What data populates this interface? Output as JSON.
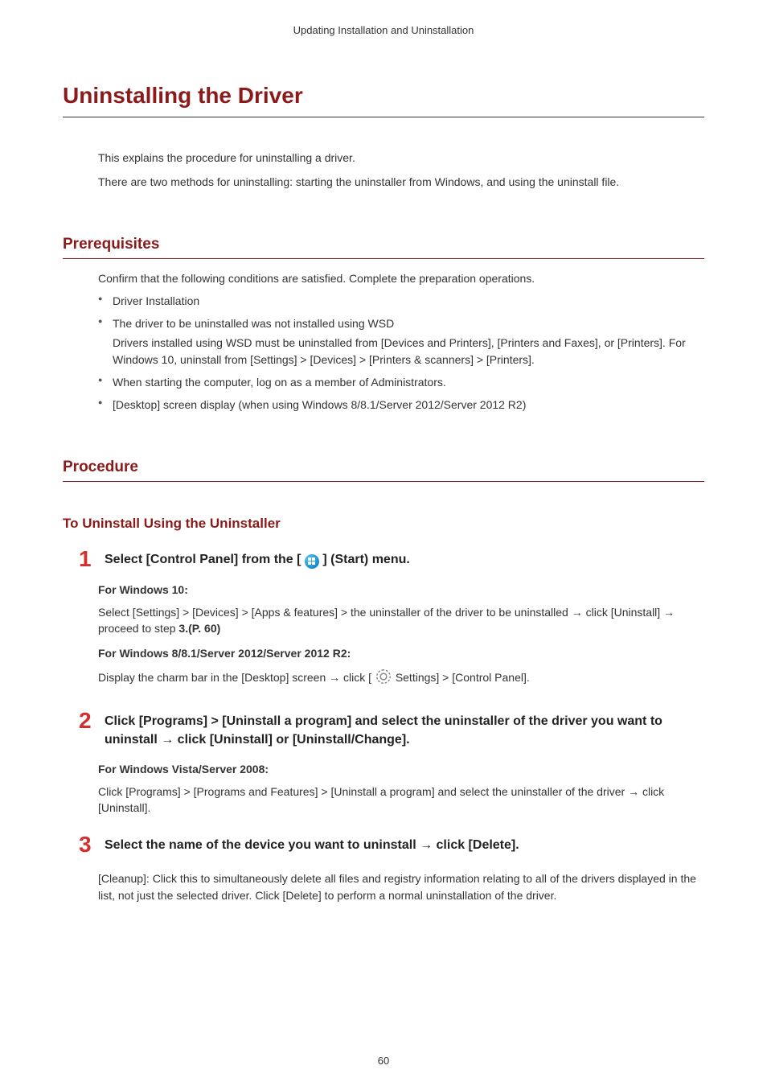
{
  "running_header": "Updating Installation and Uninstallation",
  "title": "Uninstalling the Driver",
  "intro": {
    "p1": "This explains the procedure for uninstalling a driver.",
    "p2": "There are two methods for uninstalling: starting the uninstaller from Windows, and using the uninstall file."
  },
  "prerequisites": {
    "heading": "Prerequisites",
    "lead": "Confirm that the following conditions are satisfied. Complete the preparation operations.",
    "items": [
      {
        "text": "Driver Installation"
      },
      {
        "text": "The driver to be uninstalled was not installed using WSD",
        "note": "Drivers installed using WSD must be uninstalled from [Devices and Printers], [Printers and Faxes], or [Printers]. For Windows 10, uninstall from [Settings] > [Devices] > [Printers & scanners] > [Printers]."
      },
      {
        "text": "When starting the computer, log on as a member of Administrators."
      },
      {
        "text": "[Desktop] screen display (when using Windows 8/8.1/Server 2012/Server 2012 R2)"
      }
    ]
  },
  "procedure": {
    "heading": "Procedure",
    "sub_heading": "To Uninstall Using the Uninstaller",
    "steps": [
      {
        "number": "1",
        "title_before": "Select [Control Panel] from the [",
        "title_after": "] (Start) menu.",
        "body": {
          "win10_head": "For Windows 10:",
          "win10_text_a": "Select [Settings] > [Devices] > [Apps & features] > the uninstaller of the driver to be uninstalled → click [Uninstall] → proceed to step ",
          "win10_ref": "3.(P. 60)",
          "win8_head": "For Windows 8/8.1/Server 2012/Server 2012 R2:",
          "win8_text_a": "Display the charm bar in the [Desktop] screen → click [",
          "win8_text_b": " Settings] > [Control Panel]."
        }
      },
      {
        "number": "2",
        "title": "Click [Programs] > [Uninstall a program] and select the uninstaller of the driver you want to uninstall → click [Uninstall] or [Uninstall/Change].",
        "body": {
          "vista_head": "For Windows Vista/Server 2008:",
          "vista_text": "Click [Programs] > [Programs and Features] > [Uninstall a program] and select the uninstaller of the driver → click [Uninstall]."
        }
      },
      {
        "number": "3",
        "title": "Select the name of the device you want to uninstall → click [Delete].",
        "body": {
          "cleanup_text": "[Cleanup]: Click this to simultaneously delete all files and registry information relating to all of the drivers displayed in the list, not just the selected driver. Click [Delete] to perform a normal uninstallation of the driver."
        }
      }
    ]
  },
  "page_number": "60"
}
